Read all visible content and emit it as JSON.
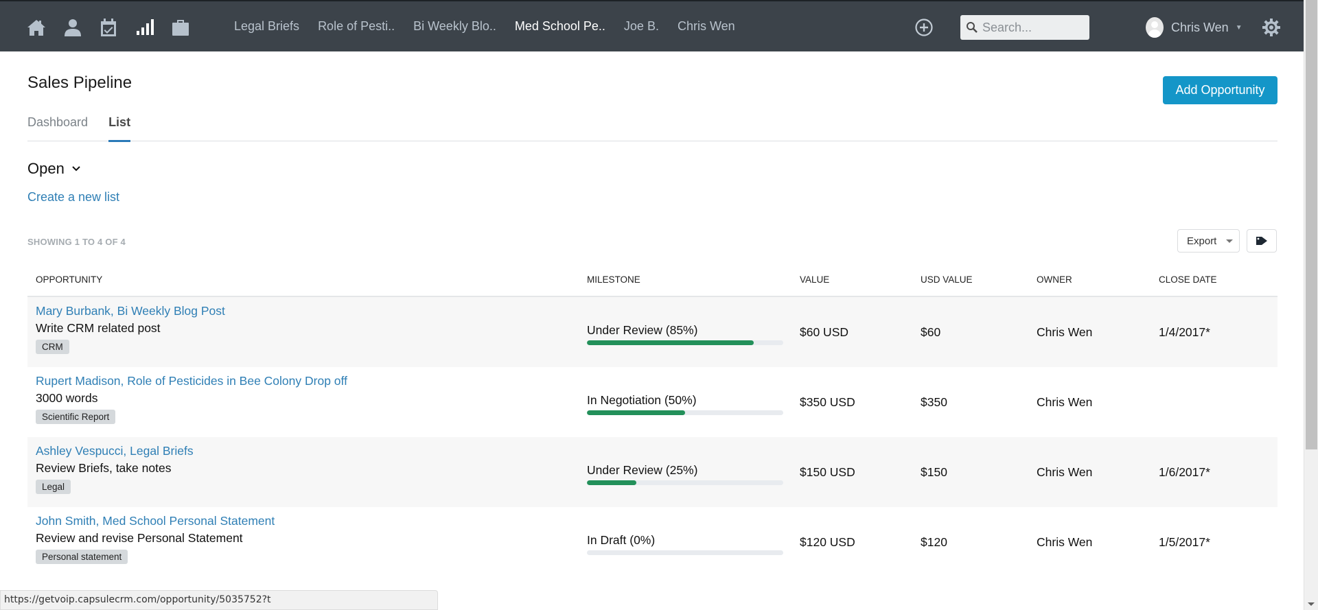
{
  "topnav": {
    "icons": [
      "home-icon",
      "person-icon",
      "calendar-check-icon",
      "signal-bars-icon",
      "briefcase-icon"
    ],
    "links": [
      {
        "label": "Legal Briefs",
        "active": false
      },
      {
        "label": "Role of Pesti..",
        "active": false
      },
      {
        "label": "Bi Weekly Blo..",
        "active": false
      },
      {
        "label": "Med School Pe..",
        "active": true
      },
      {
        "label": "Joe B.",
        "active": false
      },
      {
        "label": "Chris Wen",
        "active": false
      }
    ],
    "search_placeholder": "Search...",
    "user_name": "Chris Wen"
  },
  "page": {
    "title": "Sales Pipeline",
    "add_button": "Add Opportunity",
    "tabs": [
      {
        "label": "Dashboard",
        "active": false
      },
      {
        "label": "List",
        "active": true
      }
    ],
    "filter": "Open",
    "create_list_link": "Create a new list",
    "showing": "SHOWING 1 TO 4 OF 4",
    "export_button": "Export"
  },
  "table": {
    "columns": [
      "OPPORTUNITY",
      "MILESTONE",
      "VALUE",
      "USD VALUE",
      "OWNER",
      "CLOSE DATE"
    ],
    "rows": [
      {
        "title": "Mary Burbank, Bi Weekly Blog Post",
        "description": "Write CRM related post",
        "tag": "CRM",
        "milestone": "Under Review (85%)",
        "progress": 85,
        "value": "$60 USD",
        "usd_value": "$60",
        "owner": "Chris Wen",
        "close_date": "1/4/2017*"
      },
      {
        "title": "Rupert Madison, Role of Pesticides in Bee Colony Drop off",
        "description": "3000 words",
        "tag": "Scientific Report",
        "milestone": "In Negotiation (50%)",
        "progress": 50,
        "value": "$350 USD",
        "usd_value": "$350",
        "owner": "Chris Wen",
        "close_date": ""
      },
      {
        "title": "Ashley Vespucci, Legal Briefs",
        "description": "Review Briefs, take notes",
        "tag": "Legal",
        "milestone": "Under Review (25%)",
        "progress": 25,
        "value": "$150 USD",
        "usd_value": "$150",
        "owner": "Chris Wen",
        "close_date": "1/6/2017*"
      },
      {
        "title": "John Smith, Med School Personal Statement",
        "description": "Review and revise Personal Statement",
        "tag": "Personal statement",
        "milestone": "In Draft (0%)",
        "progress": 0,
        "value": "$120 USD",
        "usd_value": "$120",
        "owner": "Chris Wen",
        "close_date": "1/5/2017*"
      }
    ]
  },
  "statusbar": {
    "url": "https://getvoip.capsulecrm.com/opportunity/5035752?t"
  },
  "colors": {
    "topbar": "#3c434a",
    "accent": "#1496c8",
    "link": "#2f7fb5",
    "progress": "#23905a"
  }
}
